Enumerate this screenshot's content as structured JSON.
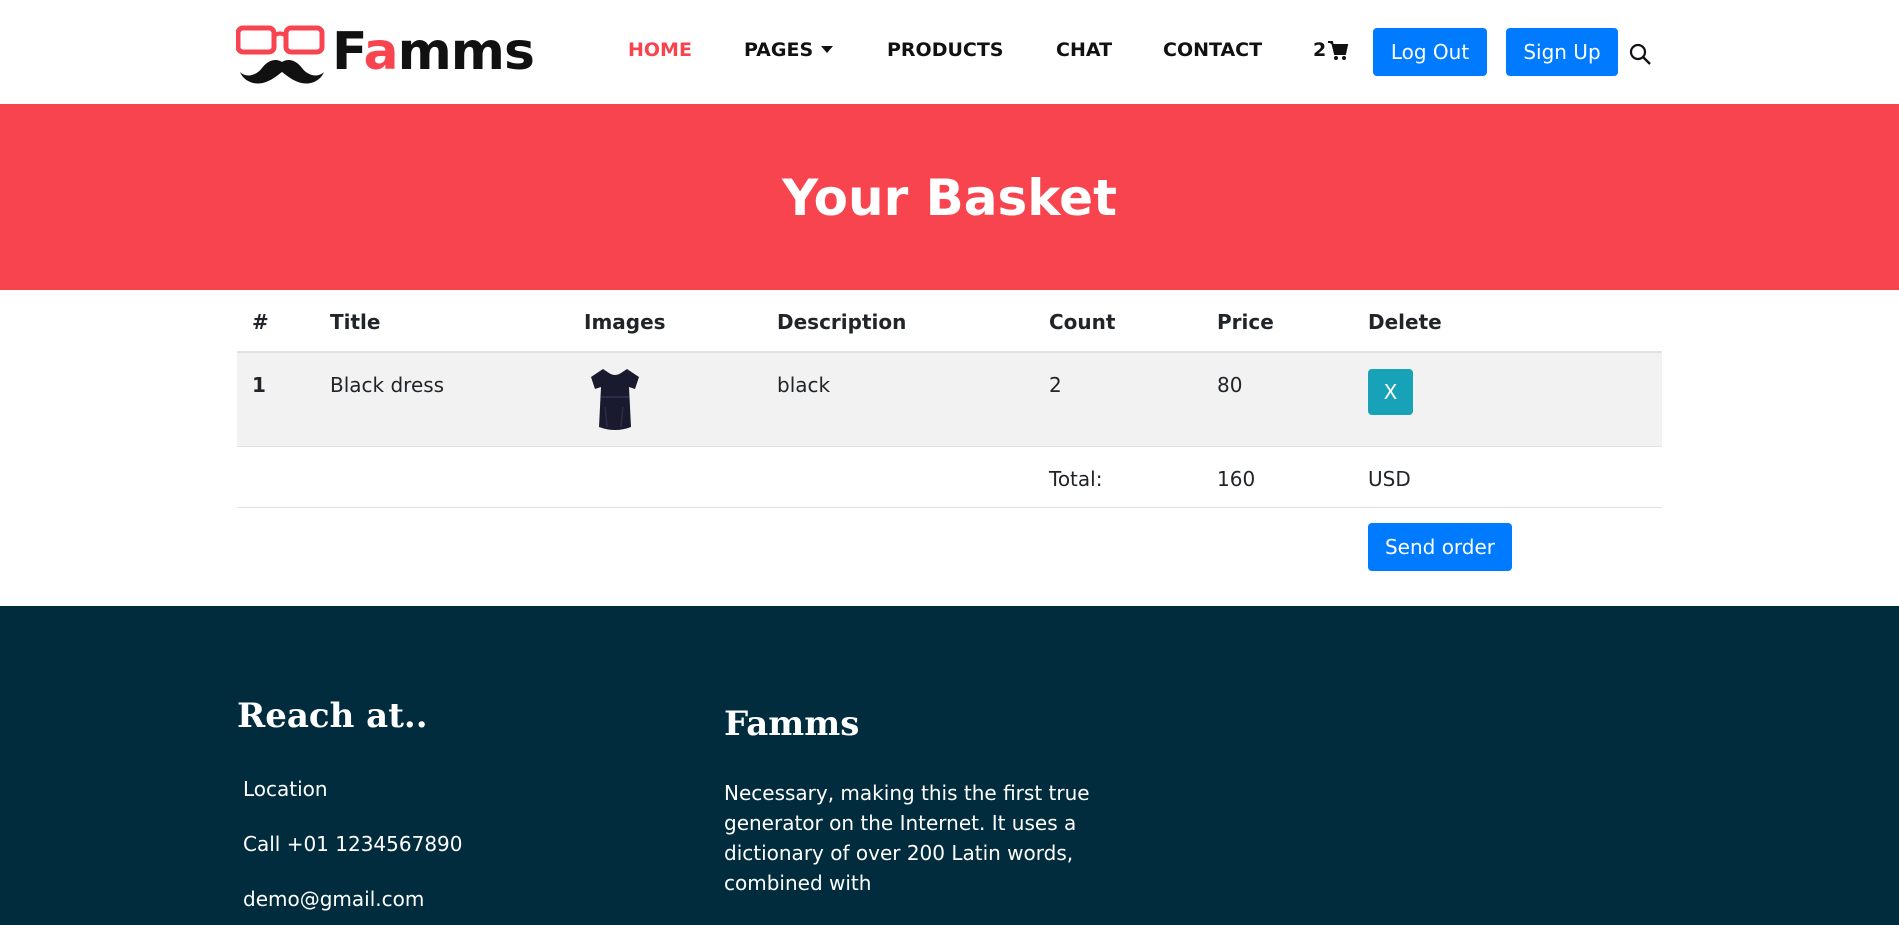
{
  "brand": {
    "name_prefix": "F",
    "name_accent": "a",
    "name_suffix": "mms"
  },
  "nav": {
    "home": "HOME",
    "pages": "PAGES",
    "products": "PRODUCTS",
    "chat": "CHAT",
    "contact": "CONTACT",
    "cart_count": "2",
    "logout": "Log Out",
    "signup": "Sign Up"
  },
  "banner": {
    "title": "Your Basket"
  },
  "table": {
    "headers": [
      "#",
      "Title",
      "Images",
      "Description",
      "Count",
      "Price",
      "Delete"
    ],
    "rows": [
      {
        "index": "1",
        "title": "Black dress",
        "image": "black-dress-image",
        "description": "black",
        "count": "2",
        "price": "80",
        "delete_label": "X"
      }
    ],
    "total_label": "Total:",
    "total_value": "160",
    "currency": "USD",
    "send_order": "Send order"
  },
  "footer": {
    "reach_title": "Reach at..",
    "location": "Location",
    "phone": "Call +01 1234567890",
    "email": "demo@gmail.com",
    "about_title": "Famms",
    "about_text": "Necessary, making this the first true generator on the Internet. It uses a dictionary of over 200 Latin words, combined with"
  },
  "colors": {
    "accent": "#f7444e",
    "primary": "#007bff",
    "info": "#17a2b8",
    "footer_bg": "#002c3e"
  }
}
